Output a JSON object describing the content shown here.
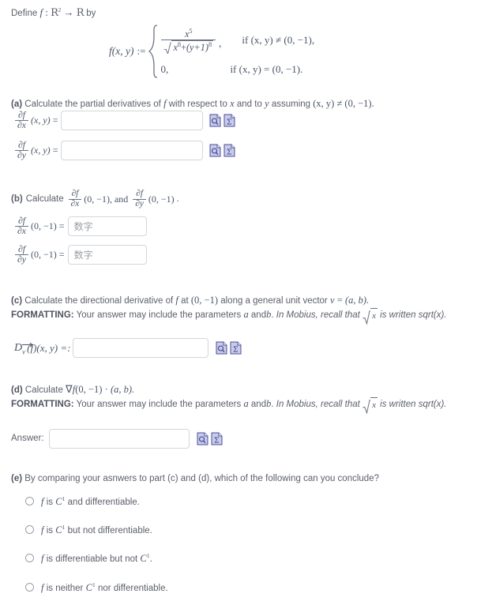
{
  "intro": {
    "define_text": "Define",
    "f_symbol": "f",
    "colon": ":",
    "domain": "R",
    "domain_exp": "2",
    "arrow": "→",
    "codomain": "R",
    "by_text": "by"
  },
  "definition": {
    "lhs": "f(x, y)",
    "assign": ":=",
    "case1": {
      "numerator_base": "x",
      "numerator_exp": "5",
      "denom_term1_base": "x",
      "denom_term1_exp": "8",
      "denom_plus": "+",
      "denom_term2_base": "(y+1)",
      "denom_term2_exp": "8",
      "comma": ",",
      "condition": "if (x, y) ≠ (0, −1),"
    },
    "case2": {
      "value": "0,",
      "condition": "if (x, y) = (0, −1)."
    }
  },
  "part_a": {
    "label": "(a)",
    "prompt_pre": "Calculate the partial derivatives of",
    "prompt_f": "f",
    "prompt_mid": "with respect to",
    "prompt_x": "x",
    "prompt_and": "and to",
    "prompt_y": "y",
    "prompt_post": "assuming",
    "prompt_cond": "(x, y) ≠ (0, −1).",
    "rows": [
      {
        "numerator": "∂f",
        "denominator": "∂x",
        "args": "(x, y)",
        "equals": "=",
        "value": "",
        "placeholder": ""
      },
      {
        "numerator": "∂f",
        "denominator": "∂y",
        "args": "(x, y)",
        "equals": "=",
        "value": "",
        "placeholder": ""
      }
    ]
  },
  "part_b": {
    "label": "(b)",
    "prompt_pre": "Calculate",
    "prompt_frac1_num": "∂f",
    "prompt_frac1_den": "∂x",
    "prompt_args1": "(0, −1), and",
    "prompt_frac2_num": "∂f",
    "prompt_frac2_den": "∂y",
    "prompt_args2": "(0, −1)",
    "prompt_end": ".",
    "rows": [
      {
        "numerator": "∂f",
        "denominator": "∂x",
        "args": "(0, −1)",
        "equals": "=",
        "value": "",
        "placeholder": "数字"
      },
      {
        "numerator": "∂f",
        "denominator": "∂y",
        "args": "(0, −1)",
        "equals": "=",
        "value": "",
        "placeholder": "数字"
      }
    ]
  },
  "part_c": {
    "label": "(c)",
    "prompt_pre": "Calculate the directional derivative of",
    "prompt_f": "f",
    "prompt_at": "at",
    "prompt_point": "(0, −1)",
    "prompt_mid": "along a general unit vector",
    "prompt_v": "v",
    "prompt_eq": "=",
    "prompt_ab": "(a, b).",
    "formatting_label": "FORMATTING:",
    "formatting_text_1": "Your answer may include the parameters",
    "formatting_a": "a",
    "formatting_and": "and",
    "formatting_b": "b",
    "formatting_period": ".",
    "formatting_italic_1": "In Mobius, recall that",
    "formatting_sqrt": "x",
    "formatting_italic_2": "is written sqrt(x).",
    "answer_D": "D",
    "answer_sub_v": "v",
    "answer_rest": "(f)(x, y) =:",
    "value": "",
    "placeholder": ""
  },
  "part_d": {
    "label": "(d)",
    "prompt_pre": "Calculate",
    "prompt_nabla": "∇",
    "prompt_f": "f",
    "prompt_point": "(0, −1)",
    "prompt_dot": "·",
    "prompt_ab": "(a, b).",
    "formatting_label": "FORMATTING:",
    "formatting_text_1": "Your answer may include the parameters",
    "formatting_a": "a",
    "formatting_and": "and",
    "formatting_b": "b",
    "formatting_period": ".",
    "formatting_italic_1": "In Mobius, recall that",
    "formatting_sqrt": "x",
    "formatting_italic_2": "is written sqrt(x).",
    "answer_label": "Answer:",
    "value": "",
    "placeholder": ""
  },
  "part_e": {
    "label": "(e)",
    "prompt": "By comparing your asnwers to part (c) and (d),  which of the following can you conclude?",
    "options": [
      {
        "pre": "f",
        "is": "is",
        "cls": "C",
        "exp": "1",
        "post": "and differentiable.",
        "selected": false
      },
      {
        "pre": "f",
        "is": "is",
        "cls": "C",
        "exp": "1",
        "post": "but not differentiable.",
        "selected": false
      },
      {
        "pre": "f",
        "is": "is differentiable but not",
        "cls": "C",
        "exp": "1",
        "post": ".",
        "selected": false
      },
      {
        "pre": "f",
        "is": "is neither",
        "cls": "C",
        "exp": "1",
        "post": "nor differentiable.",
        "selected": false
      }
    ]
  },
  "icons": {
    "preview": "document-magnifier-icon",
    "math": "document-sigma-icon",
    "preview_title": "Preview",
    "math_title": "Math equation editor"
  },
  "colors": {
    "text": "#5b5f6b",
    "math": "#4a5568",
    "input_border": "#d4d6db",
    "icon_fill": "#c9cbe8",
    "icon_stroke": "#4a4f9e",
    "placeholder": "#9aa0a6"
  }
}
